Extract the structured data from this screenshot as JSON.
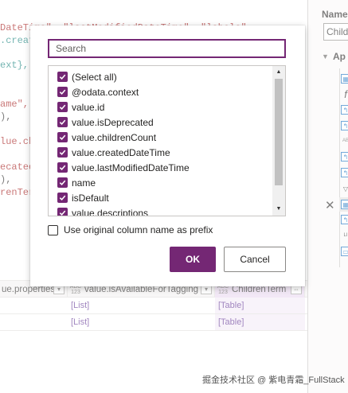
{
  "editor": {
    "lines": [
      {
        "segments": [
          {
            "t": "DateTime\", \"lastModifiedDateTime\", \"labels\"",
            "c": "str"
          }
        ]
      },
      {
        "segments": [
          {
            "t": ".creat",
            "c": "teal"
          }
        ]
      },
      {
        "segments": [
          {
            "t": "ext}, ",
            "c": "teal"
          },
          {
            "t": "",
            "c": "plain"
          }
        ]
      },
      {
        "segments": [
          {
            "t": "ame\",",
            "c": "str"
          }
        ]
      },
      {
        "segments": [
          {
            "t": "),",
            "c": "plain"
          }
        ]
      },
      {
        "segments": [
          {
            "t": "lue.ch",
            "c": "str"
          }
        ]
      },
      {
        "segments": [
          {
            "t": "ecated",
            "c": "str"
          }
        ]
      },
      {
        "segments": [
          {
            "t": "),",
            "c": "plain"
          }
        ]
      },
      {
        "segments": [
          {
            "t": "renTerm",
            "c": "str"
          }
        ]
      }
    ]
  },
  "grid": {
    "columns": [
      {
        "type_badge": "",
        "label": "ue.properties"
      },
      {
        "type_badge": "ABC 123",
        "label": "value.isAvailableForTagging"
      },
      {
        "type_badge": "ABC 123",
        "label": "ChildrenTerm"
      }
    ],
    "rows": [
      [
        "",
        "[List]",
        "[Table]"
      ],
      [
        "",
        "[List]",
        "[Table]"
      ]
    ]
  },
  "settings": {
    "name_label": "Name",
    "name_value": "Childr",
    "applied_steps_label": "Ap"
  },
  "dialog": {
    "search_placeholder": "Search",
    "columns": [
      {
        "label": "(Select all)",
        "checked": true
      },
      {
        "label": "@odata.context",
        "checked": true
      },
      {
        "label": "value.id",
        "checked": true
      },
      {
        "label": "value.isDeprecated",
        "checked": true
      },
      {
        "label": "value.childrenCount",
        "checked": true
      },
      {
        "label": "value.createdDateTime",
        "checked": true
      },
      {
        "label": "value.lastModifiedDateTime",
        "checked": true
      },
      {
        "label": "name",
        "checked": true
      },
      {
        "label": "isDefault",
        "checked": true
      },
      {
        "label": "value.descriptions",
        "checked": true
      }
    ],
    "prefix_option": {
      "label": "Use original column name as prefix",
      "checked": false
    },
    "ok_label": "OK",
    "cancel_label": "Cancel"
  },
  "watermark": "掘金技术社区 @ 紫电青霜_FullStack",
  "colors": {
    "accent": "#742774",
    "link": "#5c2d91",
    "selected_header": "#e9d7f0"
  },
  "icons": [
    "checkbox-checked-icon",
    "scroll-up-icon",
    "scroll-down-icon",
    "filter-dropdown-icon",
    "delete-step-icon",
    "step-icon",
    "expand-chevron-icon"
  ]
}
